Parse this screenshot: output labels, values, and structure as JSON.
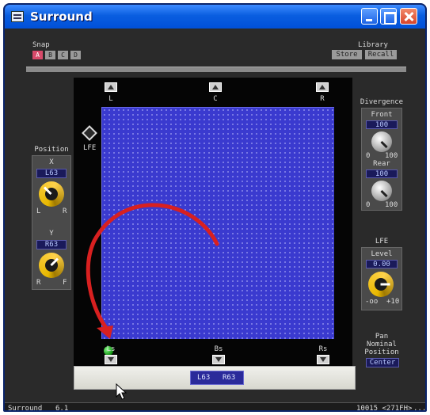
{
  "window": {
    "title": "Surround"
  },
  "snap": {
    "label": "Snap",
    "buttons": [
      "A",
      "B",
      "C",
      "D"
    ],
    "active": "A"
  },
  "library": {
    "label": "Library",
    "store": "Store",
    "recall": "Recall"
  },
  "speakers": {
    "l": "L",
    "c": "C",
    "r": "R",
    "lfe": "LFE",
    "ls": "Ls",
    "bs": "Bs",
    "rs": "Rs"
  },
  "position": {
    "label": "Position",
    "x_label": "X",
    "x_value": "L63",
    "x_left": "L",
    "x_right": "R",
    "y_label": "Y",
    "y_value": "R63",
    "y_left": "R",
    "y_right": "F"
  },
  "divergence": {
    "label": "Divergence",
    "front_label": "Front",
    "front_value": "100",
    "front_min": "0",
    "front_max": "100",
    "rear_label": "Rear",
    "rear_value": "100",
    "rear_min": "0",
    "rear_max": "100"
  },
  "lfe": {
    "label": "LFE",
    "level_label": "Level",
    "level_value": "0.00",
    "min": "-oo",
    "max": "+10"
  },
  "pan": {
    "line1": "Pan",
    "line2": "Nominal",
    "line3": "Position",
    "value": "Center"
  },
  "readout": {
    "x": "L63",
    "y": "R63"
  },
  "status": {
    "left": "Surround",
    "mode": "6.1",
    "right": "10015 <271FH>",
    "ellipsis": "..."
  },
  "colors": {
    "grid": "#3a3acf",
    "dot": "#1a9a1a",
    "arrow": "#d82020",
    "title_bar": "#0a5ee0"
  }
}
